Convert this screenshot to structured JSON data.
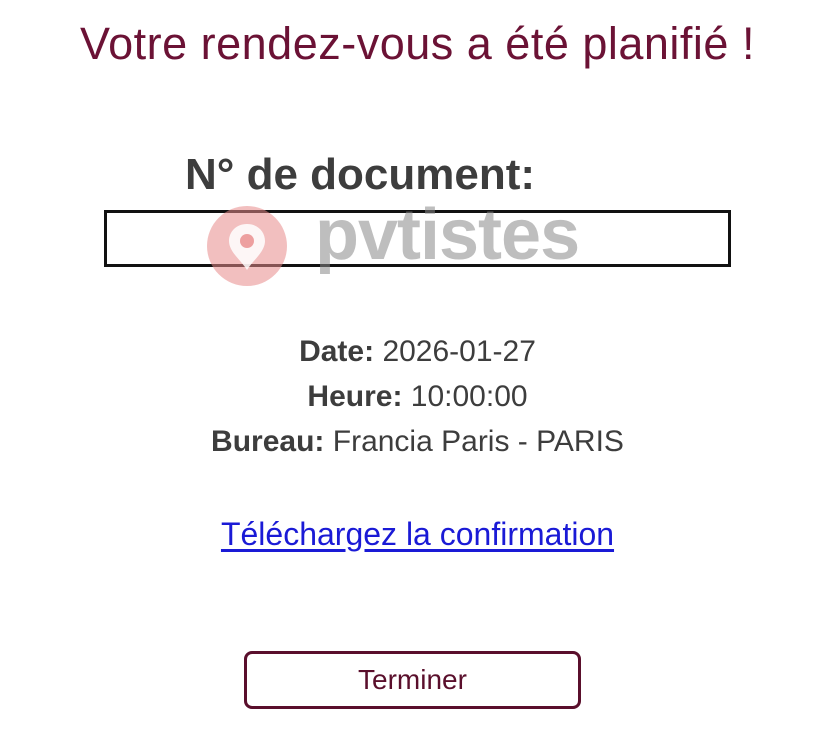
{
  "page": {
    "title": "Votre rendez-vous a été planifié !"
  },
  "document": {
    "label": "N° de document:",
    "value": ""
  },
  "watermark": {
    "text": "pvtistes",
    "icon": "pin-logo-icon",
    "pin_color": "#e88a8a"
  },
  "appointment": {
    "date_label": "Date:",
    "date_value": "2026-01-27",
    "time_label": "Heure:",
    "time_value": "10:00:00",
    "office_label": "Bureau:",
    "office_value": "Francia Paris - PARIS"
  },
  "download": {
    "link_label": "Téléchargez la confirmation"
  },
  "actions": {
    "finish_label": "Terminer"
  },
  "colors": {
    "title": "#6b1235",
    "text": "#3d3d3d",
    "link": "#1a1ad6",
    "button_border": "#5a0f2c"
  }
}
